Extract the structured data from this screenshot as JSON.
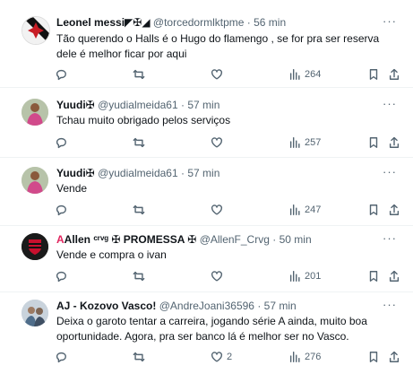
{
  "tweets": [
    {
      "name": "Leonel messi",
      "name_suffix": "◤✠◢",
      "handle": "@torcedormlktpme",
      "dot": "·",
      "time": "56 min",
      "text": "Tão querendo o Halls é o Hugo do flamengo , se for pra ser reserva dele é melhor ficar por aqui",
      "replies": "",
      "retweets": "",
      "likes": "",
      "views": "264",
      "avatar_icon": "avatar-vasco-cross"
    },
    {
      "name": "Yuudi",
      "name_suffix": "✠",
      "handle": "@yudialmeida61",
      "dot": "·",
      "time": "57 min",
      "text": "Tchau muito obrigado pelos serviços",
      "replies": "",
      "retweets": "",
      "likes": "",
      "views": "257",
      "avatar_icon": "avatar-player-photo"
    },
    {
      "name": "Yuudi",
      "name_suffix": "✠",
      "handle": "@yudialmeida61",
      "dot": "·",
      "time": "57 min",
      "text": "Vende",
      "replies": "",
      "retweets": "",
      "likes": "",
      "views": "247",
      "avatar_icon": "avatar-player-photo"
    },
    {
      "name": "Allen",
      "name_badge": "A",
      "name_suffix": "ᶜʳᵛᵍ ✠ PROMESSA ✠",
      "handle": "@AllenF_Crvg",
      "dot": "·",
      "time": "50 min",
      "text": "Vende e compra o ivan",
      "replies": "",
      "retweets": "",
      "likes": "",
      "views": "201",
      "avatar_icon": "avatar-flamengo-crest"
    },
    {
      "name": "AJ - Kozovo Vasco!",
      "name_suffix": "",
      "handle": "@AndreJoani36596",
      "dot": "·",
      "time": "57 min",
      "text": "Deixa o garoto tentar a carreira, jogando série A ainda, muito boa oportunidade. Agora, pra ser banco lá é melhor ser no Vasco.",
      "replies": "",
      "retweets": "",
      "likes": "2",
      "views": "276",
      "avatar_icon": "avatar-photo"
    }
  ],
  "more_label": "···",
  "colors": {
    "text": "#0f1419",
    "muted": "#536471",
    "divider": "#eff3f4"
  }
}
